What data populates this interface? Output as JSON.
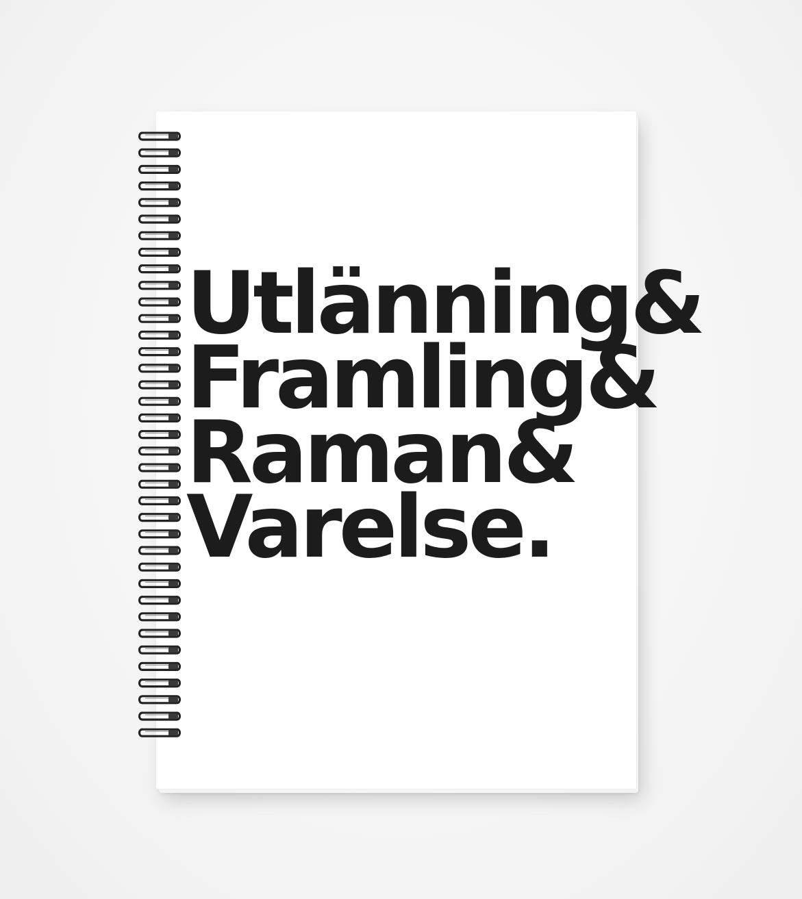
{
  "cover": {
    "lines": [
      "Utlänning&",
      "Framling&",
      "Raman&",
      "Varelse."
    ],
    "text_color": "#1c1c1c",
    "cover_color": "#ffffff",
    "background_color": "#f4f4f4"
  },
  "spiral": {
    "ring_count": 37,
    "wire_color": "#222222"
  }
}
